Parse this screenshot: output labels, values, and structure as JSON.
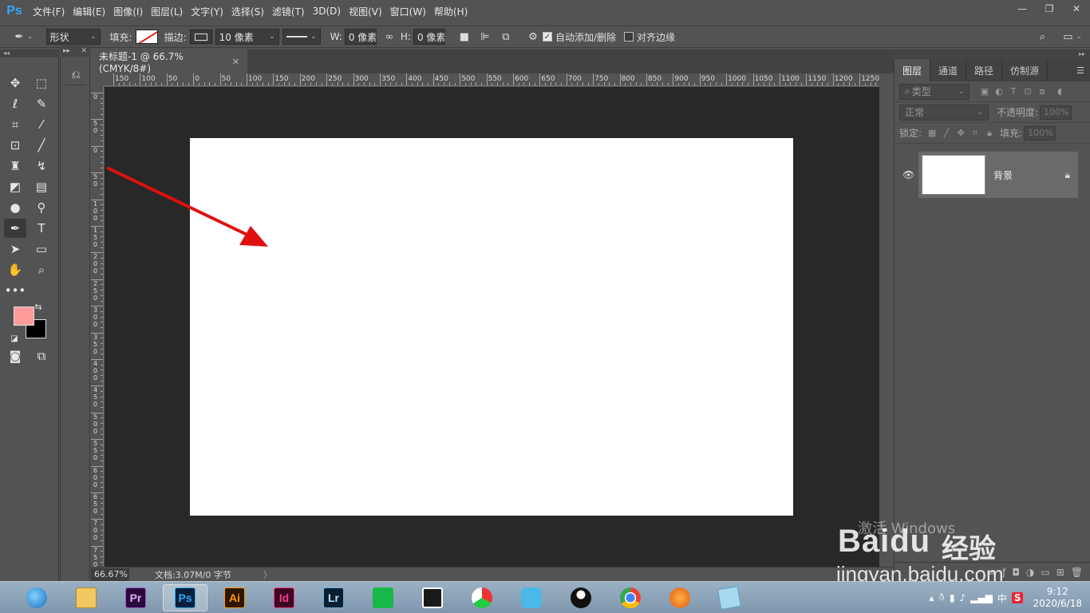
{
  "menubar": {
    "logo": "Ps",
    "items": [
      "文件(F)",
      "编辑(E)",
      "图像(I)",
      "图层(L)",
      "文字(Y)",
      "选择(S)",
      "滤镜(T)",
      "3D(D)",
      "视图(V)",
      "窗口(W)",
      "帮助(H)"
    ],
    "window_controls": [
      "—",
      "❐",
      "✕"
    ]
  },
  "options": {
    "shape_mode": "形状",
    "fill_label": "填充:",
    "stroke_label": "描边:",
    "stroke_width": "10 像素",
    "w_label": "W:",
    "w_value": "0 像素",
    "h_label": "H:",
    "h_value": "0 像素",
    "auto_add_delete": "自动添加/删除",
    "auto_add_delete_checked": true,
    "align_edges": "对齐边缘",
    "align_edges_checked": false
  },
  "document": {
    "tab_title": "未标题-1 @ 66.7%(CMYK/8#)",
    "tab_close": "✕",
    "ruler_top": [
      "150",
      "100",
      "50",
      "0",
      "50",
      "100",
      "150",
      "200",
      "250",
      "300",
      "350",
      "400",
      "450",
      "500",
      "550",
      "600",
      "650",
      "700",
      "750",
      "800",
      "850",
      "900",
      "950",
      "1000",
      "1050",
      "1100",
      "1150",
      "1200",
      "1250"
    ],
    "ruler_left": [
      "0",
      "5 0",
      "0",
      "5 0",
      "1 0 0",
      "1 5 0",
      "2 0 0",
      "2 5 0",
      "3 0 0",
      "3 5 0",
      "4 0 0",
      "4 5 0",
      "5 0 0",
      "5 5 0",
      "6 0 0",
      "6 5 0",
      "7 0 0",
      "7 5 0"
    ],
    "canvas_color": "#ffffff",
    "workspace_color": "#282828"
  },
  "status": {
    "zoom": "66.67%",
    "doc_info": "文档:3.07M/0 字节",
    "arrow": "〉"
  },
  "colors": {
    "foreground": "#fe9c9c",
    "background": "#000000",
    "accent_ps": "#31a8ff",
    "annotation_arrow": "#e01010"
  },
  "layers_panel": {
    "tabs": [
      "图层",
      "通道",
      "路径",
      "仿制源"
    ],
    "filter_placeholder": "类型",
    "blend_mode": "正常",
    "opacity_label": "不透明度:",
    "opacity_value": "100%",
    "lock_label": "锁定:",
    "fill_label": "填充:",
    "fill_value": "100%",
    "layers": [
      {
        "name": "背景",
        "visible": true,
        "locked": true
      }
    ]
  },
  "watermark": {
    "windows_activate": "激活 Windows",
    "baidu_logo": "Baidu",
    "baidu_cn": "经验",
    "baidu_url": "jingyan.baidu.com"
  },
  "taskbar": {
    "apps": [
      {
        "id": "edge",
        "label": ""
      },
      {
        "id": "explorer",
        "label": ""
      },
      {
        "id": "premiere",
        "label": "Pr"
      },
      {
        "id": "photoshop",
        "label": "Ps"
      },
      {
        "id": "illustrator",
        "label": "Ai"
      },
      {
        "id": "indesign",
        "label": "Id"
      },
      {
        "id": "lightroom",
        "label": "Lr"
      },
      {
        "id": "green-app",
        "label": ""
      },
      {
        "id": "film-app",
        "label": ""
      },
      {
        "id": "colorful-app",
        "label": ""
      },
      {
        "id": "bird-app",
        "label": ""
      },
      {
        "id": "qq",
        "label": ""
      },
      {
        "id": "chrome",
        "label": ""
      },
      {
        "id": "orange-app",
        "label": ""
      },
      {
        "id": "notes-app",
        "label": ""
      }
    ],
    "tray_ime": "中",
    "clock_time": "9:12",
    "clock_date": "2020/6/18"
  }
}
